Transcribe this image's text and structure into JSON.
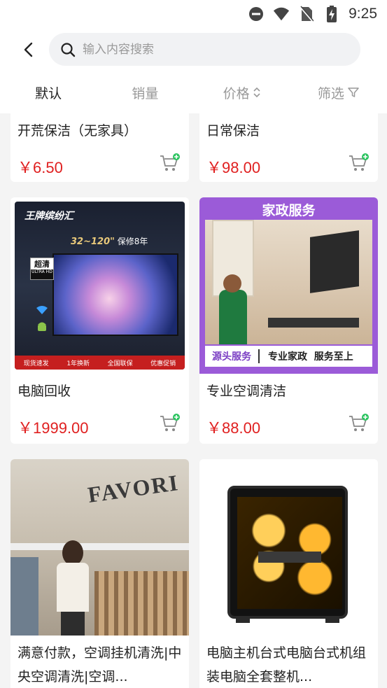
{
  "status": {
    "time": "9:25"
  },
  "search": {
    "placeholder": "输入内容搜索"
  },
  "tabs": [
    {
      "label": "默认"
    },
    {
      "label": "销量"
    },
    {
      "label": "价格"
    },
    {
      "label": "筛选"
    }
  ],
  "products": [
    {
      "title": "开荒保洁（无家具）",
      "price": "￥6.50"
    },
    {
      "title": "日常保洁",
      "price": "￥98.00"
    },
    {
      "title": "电脑回收",
      "price": "￥1999.00",
      "image_text": {
        "brand": "王牌缤纷汇",
        "size": "32~120\"",
        "warranty": "保修8年",
        "badge": "超清",
        "badge_sub": "ULTRA HD",
        "footer": [
          "现货速发",
          "1年换新",
          "全国联保",
          "优惠促销"
        ]
      }
    },
    {
      "title": "专业空调清洁",
      "price": "￥88.00",
      "image_text": {
        "header": "家政服务",
        "left": "源头服务",
        "right": "专业家政  服务至上"
      }
    },
    {
      "title": "满意付款，空调挂机清洗|中央空调清洗|空调...",
      "image_text": {
        "sign": "FAVORI"
      }
    },
    {
      "title": "电脑主机台式电脑台式机组装电脑全套整机..."
    }
  ]
}
